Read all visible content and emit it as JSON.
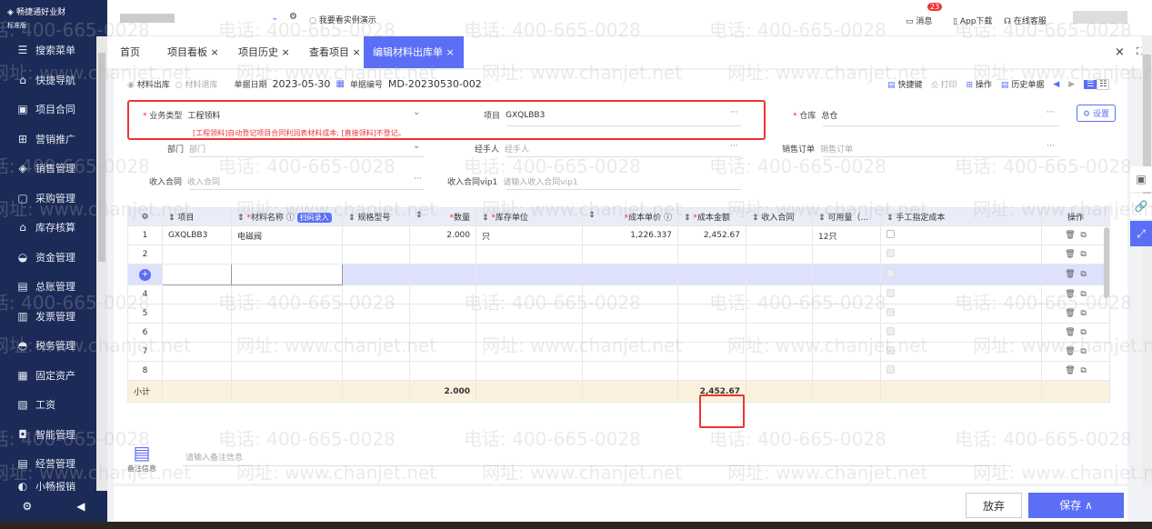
{
  "app": {
    "name": "畅捷通好业财",
    "edition": "标准版"
  },
  "sidebar": {
    "items": [
      {
        "label": "搜索菜单",
        "icon": "search-menu-icon"
      },
      {
        "label": "快捷导航",
        "icon": "home-icon"
      },
      {
        "label": "项目合同",
        "icon": "contract-icon"
      },
      {
        "label": "营销推广",
        "icon": "gift-icon"
      },
      {
        "label": "销售管理",
        "icon": "sales-icon"
      },
      {
        "label": "采购管理",
        "icon": "bag-icon"
      },
      {
        "label": "库存核算",
        "icon": "warehouse-icon"
      },
      {
        "label": "资金管理",
        "icon": "money-bag-icon"
      },
      {
        "label": "总账管理",
        "icon": "ledger-icon"
      },
      {
        "label": "发票管理",
        "icon": "invoice-icon"
      },
      {
        "label": "税务管理",
        "icon": "tax-icon"
      },
      {
        "label": "固定资产",
        "icon": "building-icon"
      },
      {
        "label": "工资",
        "icon": "salary-icon"
      },
      {
        "label": "智能管理",
        "icon": "robot-icon"
      },
      {
        "label": "经营管理",
        "icon": "clipboard-icon"
      },
      {
        "label": "小畅报销",
        "icon": "reimburse-icon"
      }
    ]
  },
  "topbar": {
    "demo": "我要看实例演示",
    "messages": "消息",
    "message_count": "23",
    "app_download": "App下载",
    "support": "在线客服"
  },
  "tabs": [
    {
      "label": "首页"
    },
    {
      "label": "项目看板 ×"
    },
    {
      "label": "项目历史 ×"
    },
    {
      "label": "查看项目 ×"
    },
    {
      "label": "编辑材料出库单 ×",
      "active": true
    }
  ],
  "doc": {
    "radio1": "材料出库",
    "radio2": "材料退库",
    "date_label": "单据日期",
    "date": "2023-05-30",
    "no_label": "单据编号",
    "no": "MD-20230530-002",
    "toolbar": {
      "shortcut": "快捷键",
      "print": "打印",
      "ops": "操作",
      "history": "历史单据"
    }
  },
  "form": {
    "biz_type_label": "业务类型",
    "biz_type": "工程领料",
    "hint": "[工程领料]自动登记项目合同利润表材料成本; [直接领料]不登记。",
    "project_label": "项目",
    "project": "GXQLBB3",
    "warehouse_label": "仓库",
    "warehouse": "总仓",
    "settings": "设置",
    "dept_label": "部门",
    "dept_ph": "部门",
    "handler_label": "经手人",
    "handler_ph": "经手人",
    "so_label": "销售订单",
    "so_ph": "销售订单",
    "income_label": "收入合同",
    "income_ph": "收入合同",
    "income_vip_label": "收入合同vip1",
    "income_vip_ph": "请输入收入合同vip1"
  },
  "table": {
    "headers": [
      "项目",
      "材料名称",
      "扫码录入",
      "规格型号",
      "数量",
      "库存单位",
      "成本单价",
      "成本金额",
      "收入合同",
      "可用量（...",
      "手工指定成本",
      "操作"
    ],
    "rows": [
      {
        "no": "1",
        "project": "GXQLBB3",
        "name": "电磁阀",
        "qty": "2.000",
        "unit": "只",
        "price": "1,226.337",
        "amount": "2,452.67",
        "avail": "12只"
      },
      {
        "no": "2"
      },
      {
        "no": "3"
      },
      {
        "no": "4"
      },
      {
        "no": "5"
      },
      {
        "no": "6"
      },
      {
        "no": "7"
      },
      {
        "no": "8"
      }
    ],
    "subtotal": {
      "label": "小计",
      "qty": "2.000",
      "amount": "2,452.67"
    }
  },
  "remarks": {
    "label": "备注信息",
    "placeholder": "请输入备注信息"
  },
  "footer": {
    "discard": "放弃",
    "save": "保存 ∧"
  },
  "watermark": {
    "phone": "电话: 400-665-0028",
    "site": "网址: www.chanjet.net"
  },
  "colors": {
    "accent": "#5b6ef5",
    "sidebar": "#1b2a57",
    "highlight": "#e33"
  }
}
